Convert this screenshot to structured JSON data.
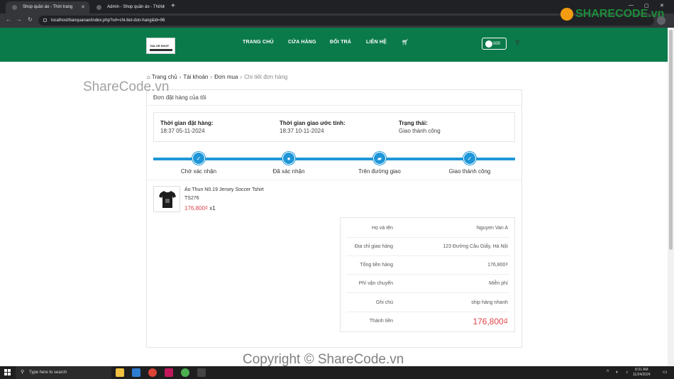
{
  "browser": {
    "tabs": [
      {
        "title": "Shop quần áo - Thời trang"
      },
      {
        "title": "Admin - Shop quần áo - Thời t"
      }
    ],
    "url": "localhost/banquanao/index.php?url=chi-tiet-don-hang&id=96"
  },
  "header": {
    "logo_text": "TAILOR SHOP",
    "nav": [
      "TRANG CHỦ",
      "CỬA HÀNG",
      "ĐỔI TRẢ",
      "LIÊN HỆ"
    ],
    "user_label": "000"
  },
  "watermarks": {
    "brand": "SHARECODE.vn",
    "top": "ShareCode.vn",
    "bottom": "Copyright © ShareCode.vn"
  },
  "breadcrumb": {
    "home": "Trang chủ",
    "account": "Tài khoản",
    "orders": "Đơn mua",
    "current": "Chi tiết đơn hàng"
  },
  "order": {
    "card_title": "Đơn đặt hàng của tôi",
    "placed_label": "Thời gian đặt hàng:",
    "placed_value": "18:37 05-11-2024",
    "eta_label": "Thời gian giao ước tính:",
    "eta_value": "18:37 10-11-2024",
    "status_label": "Trạng thái:",
    "status_value": "Giao thành công",
    "steps": [
      {
        "label": "Chờ xác nhận",
        "icon": "check-icon"
      },
      {
        "label": "Đã xác nhận",
        "icon": "user-icon"
      },
      {
        "label": "Trên đường giao",
        "icon": "truck-icon"
      },
      {
        "label": "Giao thành công",
        "icon": "check-icon"
      }
    ],
    "progress_fraction": 1.0,
    "product": {
      "name": "Áo Thun N0.19 Jersey Soccer Tshirt",
      "sku": "TS276",
      "price": "176,800₫",
      "qty": "x1"
    },
    "summary": [
      {
        "label": "Họ và tên",
        "value": "Nguyen Van A"
      },
      {
        "label": "Địa chỉ giao hàng",
        "value": "123 Đường Cầu Giấy, Hà Nội"
      },
      {
        "label": "Tổng tiền hàng",
        "value": "176,800₫"
      },
      {
        "label": "Phí vận chuyển",
        "value": "Miễn phí"
      },
      {
        "label": "Ghi chú",
        "value": "ship hàng nhanh"
      },
      {
        "label": "Thành tiền",
        "value": "176,800₫"
      }
    ]
  },
  "taskbar": {
    "search_placeholder": "Type here to search",
    "time": "8:31 AM",
    "date": "11/24/2024"
  },
  "colors": {
    "header_green": "#0b7a4b",
    "progress_blue": "#1e96d8",
    "price_red": "#e0454b"
  }
}
